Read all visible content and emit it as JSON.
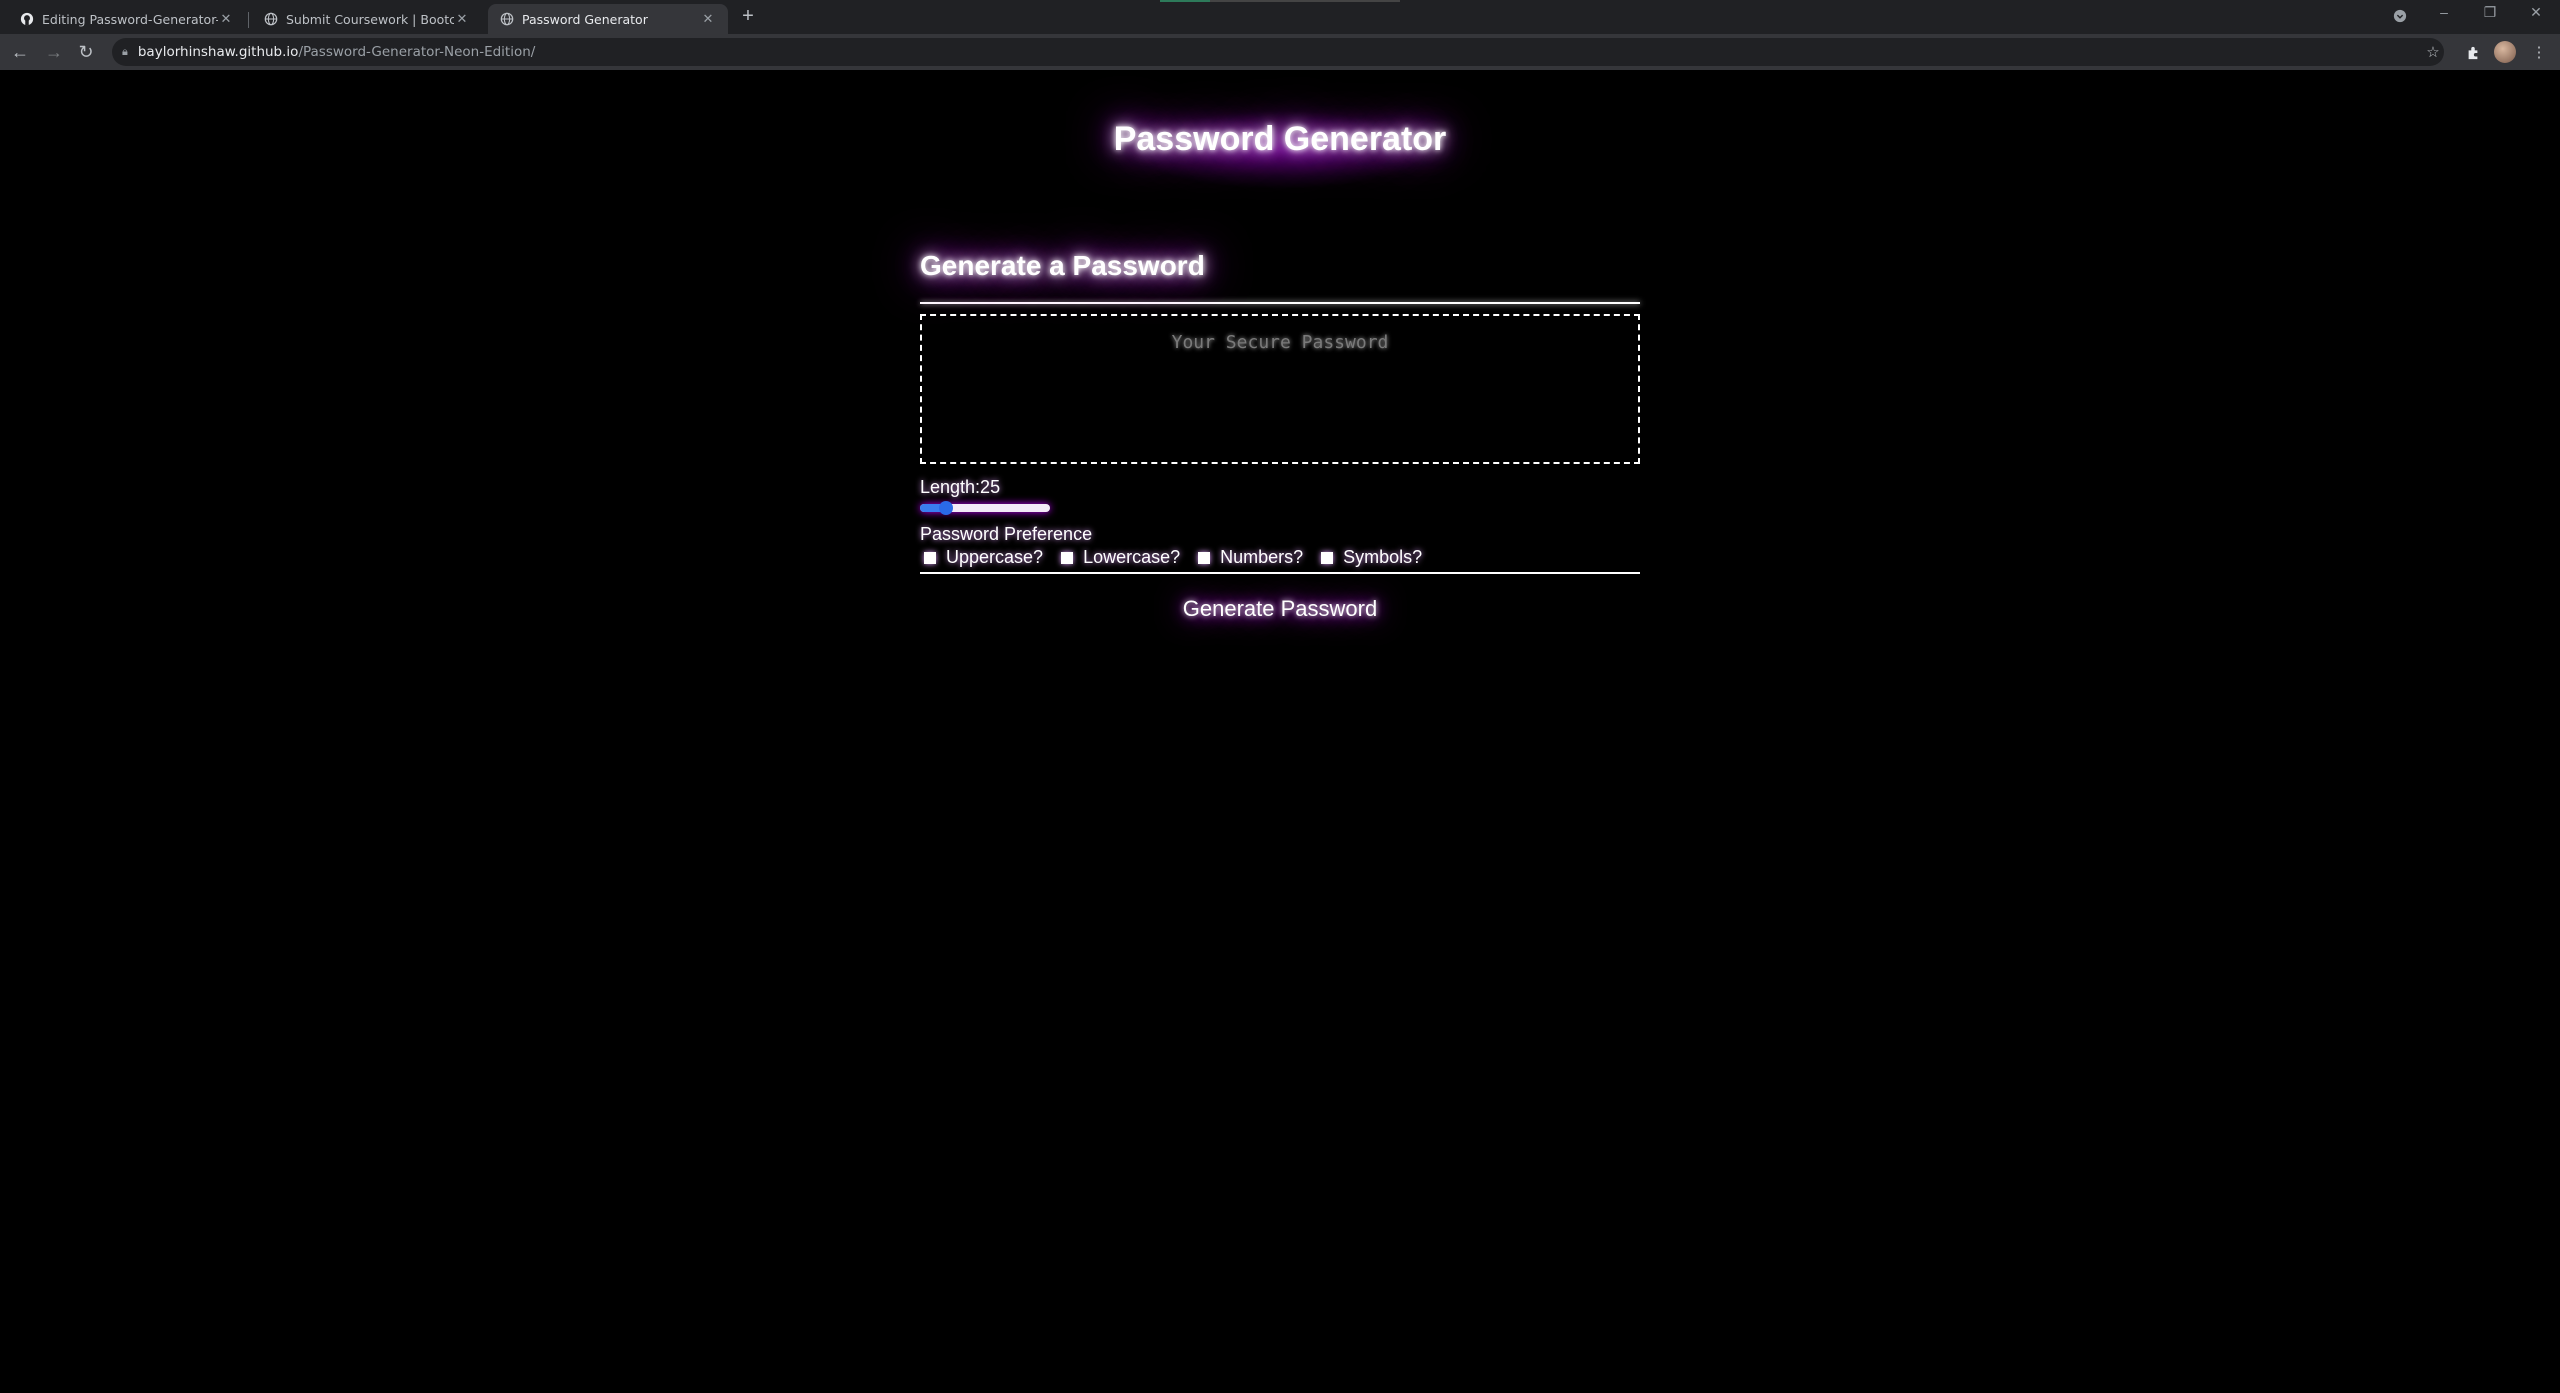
{
  "browser": {
    "tabs": [
      {
        "title": "Editing Password-Generator-Neo",
        "icon": "github-icon"
      },
      {
        "title": "Submit Coursework | Bootcamp",
        "icon": "globe-icon"
      },
      {
        "title": "Password Generator",
        "icon": "globe-icon",
        "active": true
      }
    ],
    "url_host": "baylorhinshaw.github.io",
    "url_path": "/Password-Generator-Neon-Edition/"
  },
  "page": {
    "site_title": "Password Generator",
    "card_header": "Generate a Password",
    "password_placeholder": "Your Secure Password",
    "length_label": "Length:25",
    "length_value_fraction": 0.2,
    "preference_label": "Password Preference",
    "options": [
      "Uppercase?",
      "Lowercase?",
      "Numbers?",
      "Symbols?"
    ],
    "generate_button": "Generate Password"
  },
  "colors": {
    "background": "#000000",
    "glow": "#c000ff",
    "slider_accent": "#3a7df0"
  }
}
